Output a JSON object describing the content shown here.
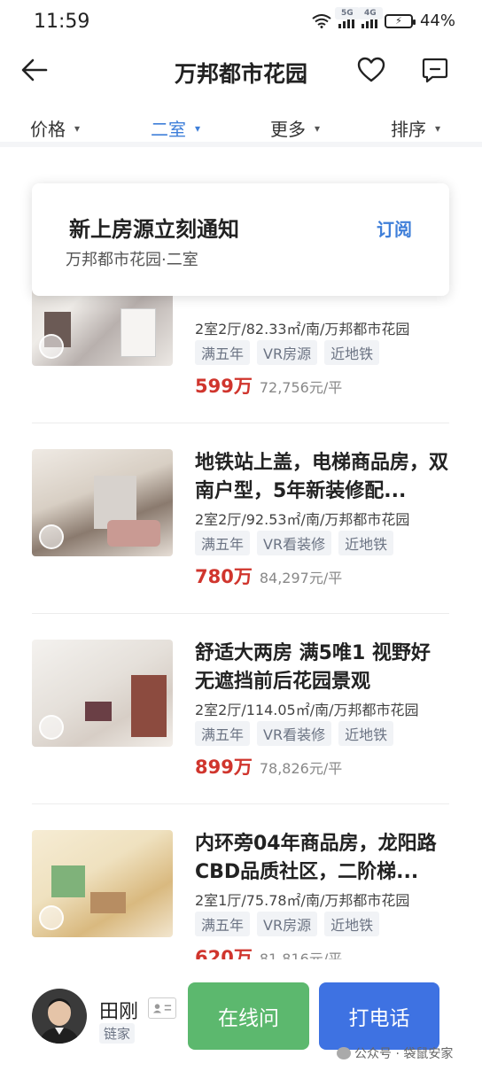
{
  "status_bar": {
    "time": "11:59",
    "net1": "5G",
    "net2": "4G",
    "battery": "44%"
  },
  "header": {
    "title": "万邦都市花园"
  },
  "filters": [
    {
      "label": "价格",
      "active": false
    },
    {
      "label": "二室",
      "active": true
    },
    {
      "label": "更多",
      "active": false
    },
    {
      "label": "排序",
      "active": false
    }
  ],
  "notify": {
    "title": "新上房源立刻通知",
    "subtitle": "万邦都市花园·二室",
    "action": "订阅"
  },
  "listings": [
    {
      "title": "",
      "info": "2室2厅/82.33㎡/南/万邦都市花园",
      "tags": [
        "满五年",
        "VR房源",
        "近地铁"
      ],
      "price": "599万",
      "unit_price": "72,756元/平"
    },
    {
      "title": "地铁站上盖，电梯商品房，双南户型，5年新装修配...",
      "info": "2室2厅/92.53㎡/南/万邦都市花园",
      "tags": [
        "满五年",
        "VR看装修",
        "近地铁"
      ],
      "price": "780万",
      "unit_price": "84,297元/平"
    },
    {
      "title": "舒适大两房 满5唯1 视野好 无遮挡前后花园景观",
      "info": "2室2厅/114.05㎡/南/万邦都市花园",
      "tags": [
        "满五年",
        "VR看装修",
        "近地铁"
      ],
      "price": "899万",
      "unit_price": "78,826元/平"
    },
    {
      "title": "内环旁04年商品房，龙阳路CBD品质社区，二阶梯...",
      "info": "2室1厅/75.78㎡/南/万邦都市花园",
      "tags": [
        "满五年",
        "VR房源",
        "近地铁"
      ],
      "price": "620万",
      "unit_price": "81,816元/平"
    }
  ],
  "agent": {
    "name": "田刚",
    "company": "链家"
  },
  "actions": {
    "online": "在线问",
    "call": "打电话"
  },
  "watermark": "公众号 · 袋鼠安家",
  "colors": {
    "accent": "#3f7fd9",
    "price": "#d0352d",
    "online_btn": "#5cb86e",
    "call_btn": "#3e72e2"
  }
}
